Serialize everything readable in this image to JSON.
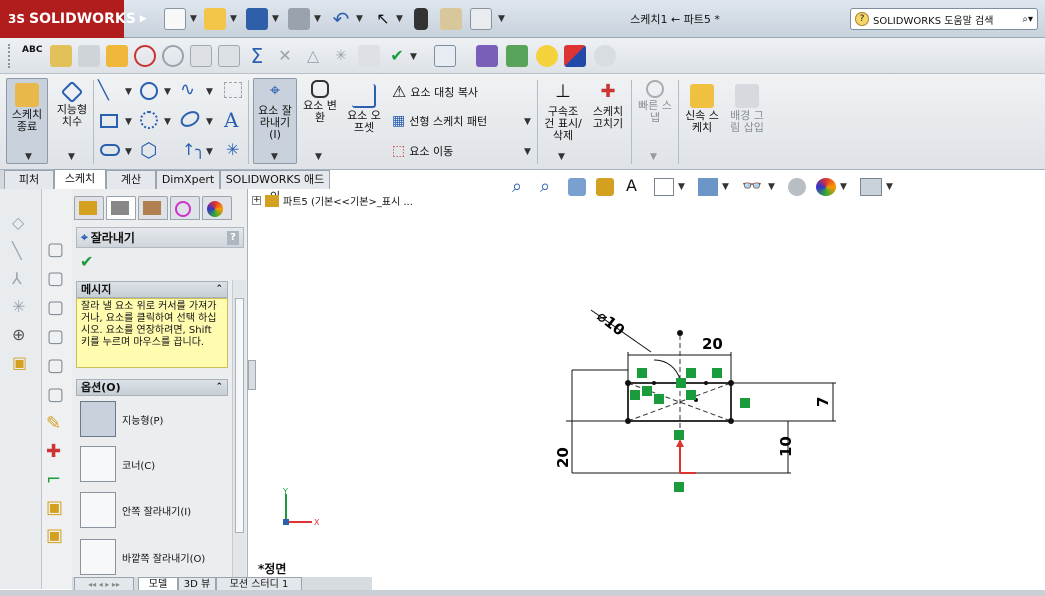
{
  "app": {
    "brand": "SOLIDWORKS",
    "brand_prefix": "3S"
  },
  "titlebar": {
    "document_title": "스케치1 ← 파트5 *",
    "help_search_placeholder": "SOLIDWORKS 도움말 검색",
    "help_icon": "question-icon"
  },
  "command_manager": {
    "sketch_exit": "스케치\n종료",
    "smart_dimension": "지능형\n치수",
    "trim_entities": "요소 잘\n라내기\n(I)",
    "convert_entities": "요소 변\n환",
    "offset_entities": "요소 오\n프셋",
    "mirror_entities": "요소 대칭 복사",
    "linear_pattern": "선형 스케치 패턴",
    "move_entities": "요소 이동",
    "display_delete_relations": "구속조\n건 표시/\n삭제",
    "repair_sketch": "스케치\n고치기",
    "quick_snaps": "빠른 스\n냅",
    "rapid_sketch": "신속 스\n케치",
    "sketch_picture": "배경 그\n림 삽입"
  },
  "cmd_tabs": [
    "피처",
    "스케치",
    "계산",
    "DimXpert",
    "SOLIDWORKS 애드인"
  ],
  "active_cmd_tab": "스케치",
  "property_manager": {
    "title": "잘라내기",
    "help_label": "?",
    "message_header": "메시지",
    "message_text": "잘라 낼 요소 위로 커서를 가져가거나, 요소를 클릭하여 선택 하십시오. 요소를 연장하려면, Shift 키를 누르며 마우스를 끕니다.",
    "options_header": "옵션(O)",
    "options": [
      {
        "label": "지능형(P)",
        "selected": true
      },
      {
        "label": "코너(C)",
        "selected": false
      },
      {
        "label": "안쪽 잘라내기(I)",
        "selected": false
      },
      {
        "label": "바깥쪽 잘라내기(O)",
        "selected": false
      }
    ]
  },
  "feature_tree": {
    "root": "파트5 (기본<<기본>_표시 ..."
  },
  "bottom_tabs": [
    "모델",
    "3D 뷰",
    "모션 스터디 1"
  ],
  "viewport": {
    "view_name": "*정면"
  },
  "sketch_dims": {
    "diameter": "⌀10",
    "width_top": "20",
    "height_right": "7",
    "height_left": "20",
    "height_right_lower": "10"
  },
  "colors": {
    "accent_red": "#b11c1c",
    "relation_green": "#1a9b3c",
    "dimension_black": "#111111",
    "sketch_selected": "#333333"
  }
}
